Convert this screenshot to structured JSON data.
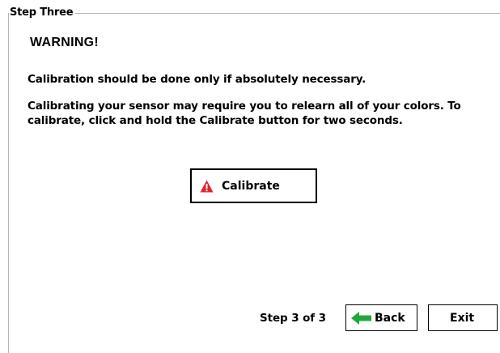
{
  "group": {
    "legend": "Step Three"
  },
  "content": {
    "warning_title": "WARNING!",
    "paragraph_1": "Calibration should be done only if absolutely necessary.",
    "paragraph_2": "Calibrating your sensor may require you to relearn all of your colors.  To calibrate, click and hold the Calibrate button for two seconds."
  },
  "calibrate_button": {
    "label": "Calibrate",
    "icon": "warning-triangle-icon",
    "icon_color": "#e8202a"
  },
  "footer": {
    "step_indicator": "Step 3 of 3",
    "back_label": "Back",
    "back_icon": "left-arrow-icon",
    "back_icon_color": "#1fa83a",
    "exit_label": "Exit"
  }
}
